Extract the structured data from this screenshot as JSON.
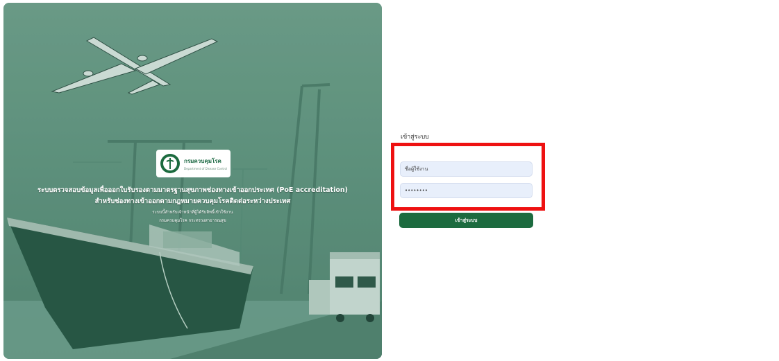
{
  "hero": {
    "logo_name": "กรมควบคุมโรค",
    "logo_subtitle": "Department of Disease Control",
    "title_line1": "ระบบตรวจสอบข้อมูลเพื่อออกใบรับรองตามมาตรฐานสุขภาพช่องทางเข้าออกประเทศ (PoE accreditation)",
    "title_line2": "สำหรับช่องทางเข้าออกตามกฎหมายควบคุมโรคติดต่อระหว่างประเทศ",
    "note_line1": "ระบบนี้สำหรับเจ้าหน้าที่ผู้ได้รับสิทธิ์เข้าใช้งาน",
    "note_line2": "กรมควบคุมโรค กระทรวงสาธารณสุข"
  },
  "login": {
    "heading": "เข้าสู่ระบบ",
    "username_value": "ชื่อผู้ใช้งาน",
    "password_value": "••••••••",
    "submit_label": "เข้าสู่ระบบ"
  },
  "colors": {
    "brand_green": "#1c6b3f",
    "input_bg": "#e8effb",
    "highlight_red": "#ee1111"
  }
}
